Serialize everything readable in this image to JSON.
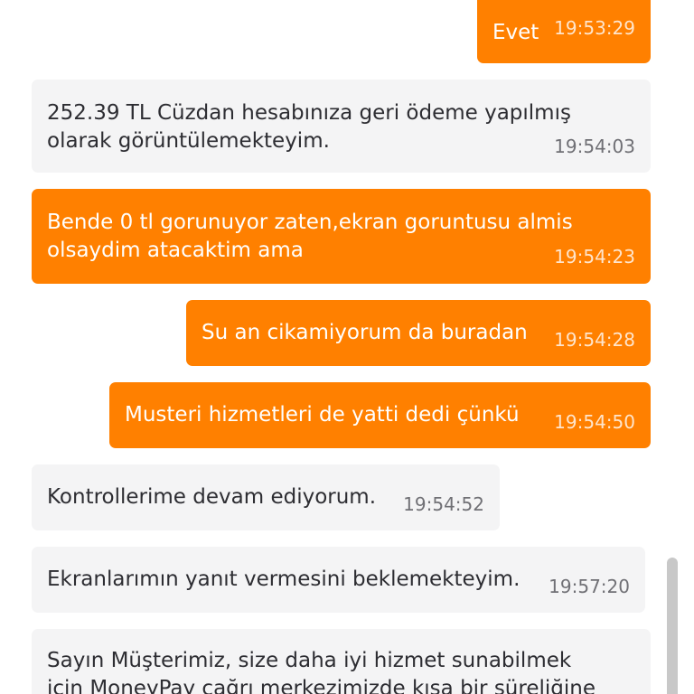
{
  "messages": [
    {
      "sender": "user",
      "text": "Evet",
      "time": "19:53:29"
    },
    {
      "sender": "agent",
      "text": "252.39 TL Cüzdan hesabınıza geri ödeme yapılmış\nolarak görüntülemekteyim.",
      "time": "19:54:03"
    },
    {
      "sender": "user",
      "text": "Bende 0 tl gorunuyor zaten,ekran goruntusu almis\nolsaydim atacaktim ama",
      "time": "19:54:23"
    },
    {
      "sender": "user",
      "text": "Su an cikamiyorum da buradan",
      "time": "19:54:28"
    },
    {
      "sender": "user",
      "text": "Musteri hizmetleri de yatti dedi çünkü",
      "time": "19:54:50"
    },
    {
      "sender": "agent",
      "text": "Kontrollerime devam ediyorum.",
      "time": "19:54:52"
    },
    {
      "sender": "agent",
      "text": "Ekranlarımın yanıt vermesini beklemekteyim.",
      "time": "19:57:20"
    },
    {
      "sender": "agent",
      "text": "Sayın Müşterimiz, size daha iyi hizmet sunabilmek\niçin MoneyPay çağrı merkezimizde kısa bir süreliğine",
      "time": ""
    }
  ],
  "colors": {
    "user_bubble": "#ff8000",
    "agent_bubble": "#f4f4f5",
    "user_text": "#ffffff",
    "agent_text": "#2d2d32"
  }
}
